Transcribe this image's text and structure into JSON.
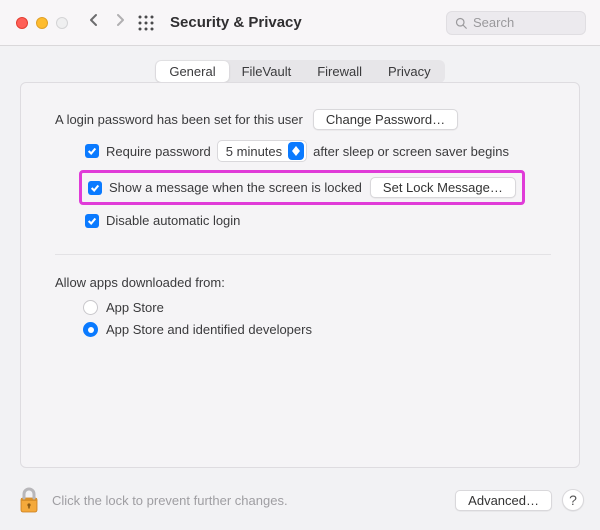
{
  "toolbar": {
    "title": "Security & Privacy",
    "search_placeholder": "Search"
  },
  "tabs": {
    "items": [
      "General",
      "FileVault",
      "Firewall",
      "Privacy"
    ],
    "active_index": 0
  },
  "general": {
    "login_password_text": "A login password has been set for this user",
    "change_password_label": "Change Password…",
    "require_password_label": "Require password",
    "require_password_checked": true,
    "require_password_delay": "5 minutes",
    "require_password_suffix": "after sleep or screen saver begins",
    "show_message_label": "Show a message when the screen is locked",
    "show_message_checked": true,
    "set_lock_message_label": "Set Lock Message…",
    "disable_auto_login_label": "Disable automatic login",
    "disable_auto_login_checked": true,
    "allow_apps_label": "Allow apps downloaded from:",
    "allow_apps_options": [
      "App Store",
      "App Store and identified developers"
    ],
    "allow_apps_selected_index": 1
  },
  "footer": {
    "lock_text": "Click the lock to prevent further changes.",
    "advanced_label": "Advanced…",
    "help_label": "?"
  }
}
